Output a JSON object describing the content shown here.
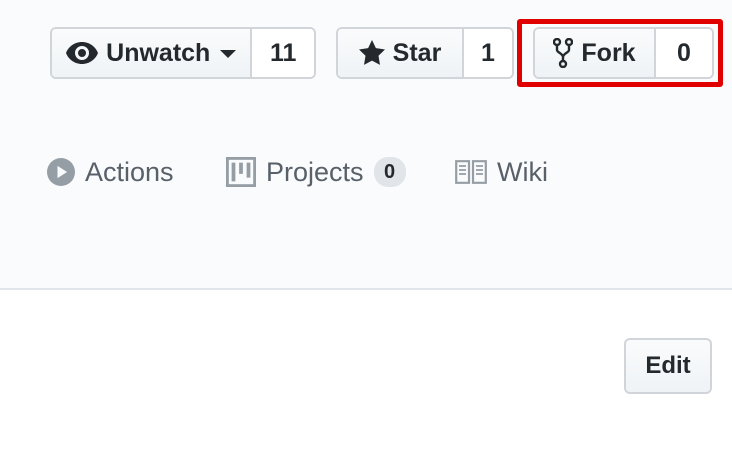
{
  "repo_actions": {
    "watch": {
      "label": "Unwatch",
      "count": "11",
      "icon": "eye-icon"
    },
    "star": {
      "label": "Star",
      "count": "1",
      "icon": "star-icon"
    },
    "fork": {
      "label": "Fork",
      "count": "0",
      "icon": "repo-forked-icon",
      "highlighted": true,
      "highlight_color": "#e00000"
    }
  },
  "repo_nav": [
    {
      "label": "Actions",
      "icon": "play-icon"
    },
    {
      "label": "Projects",
      "icon": "project-icon",
      "counter": "0"
    },
    {
      "label": "Wiki",
      "icon": "book-icon"
    }
  ],
  "edit_button": {
    "label": "Edit"
  },
  "colors": {
    "header_bg": "#fafbfc",
    "border": "#d1d5da",
    "text": "#24292e",
    "muted": "#586069"
  }
}
